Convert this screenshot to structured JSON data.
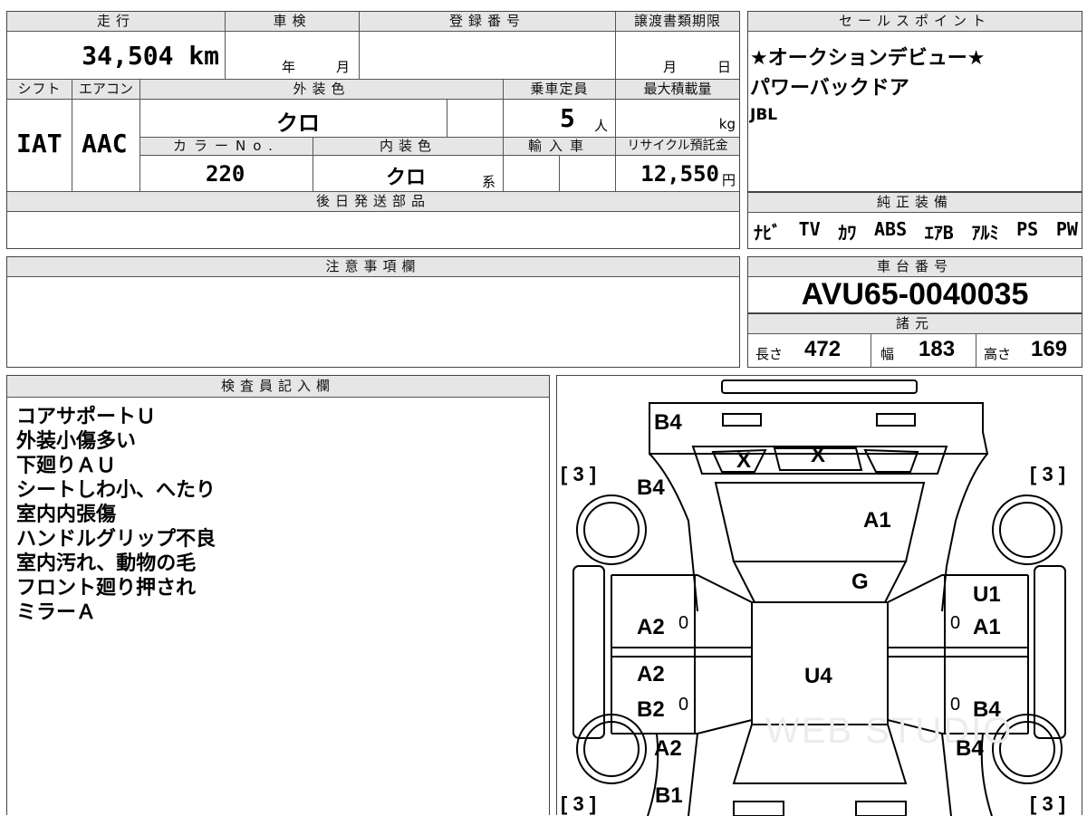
{
  "top_info": {
    "mileage_label": "走行",
    "mileage_value": "34,504 km",
    "inspection_label": "車検",
    "inspection_year_unit": "年",
    "inspection_month_unit": "月",
    "registration_label": "登録番号",
    "transfer_deadline_label": "譲渡書類期限",
    "transfer_month_unit": "月",
    "transfer_day_unit": "日",
    "shift_label": "シフト",
    "shift_value": "IAT",
    "aircon_label": "エアコン",
    "aircon_value": "AAC",
    "exterior_color_label": "外装色",
    "exterior_color_value": "クロ",
    "capacity_label": "乗車定員",
    "capacity_value": "5",
    "capacity_unit": "人",
    "max_load_label": "最大積載量",
    "max_load_unit": "kg",
    "color_no_label": "カラーNo.",
    "color_no_value": "220",
    "interior_color_label": "内装色",
    "interior_color_value": "クロ",
    "interior_color_suffix": "系",
    "import_label": "輸入車",
    "recycle_label": "リサイクル預託金",
    "recycle_value": "12,550",
    "recycle_unit": "円",
    "shipping_parts_label": "後日発送部品"
  },
  "sales_points": {
    "header": "セールスポイント",
    "items": [
      "★オークションデビュー★",
      "パワーバックドア",
      "JBL"
    ]
  },
  "genuine_equipment": {
    "header": "純正装備",
    "items": [
      "ﾅﾋﾞ",
      "TV",
      "ｶﾜ",
      "ABS",
      "ｴｱB",
      "ｱﾙﾐ",
      "PS",
      "PW"
    ]
  },
  "notes": {
    "header": "注意事項欄"
  },
  "chassis": {
    "header": "車台番号",
    "value": "AVU65-0040035"
  },
  "specs": {
    "header": "諸元",
    "length_label": "長さ",
    "length_value": "472",
    "width_label": "幅",
    "width_value": "183",
    "height_label": "高さ",
    "height_value": "169"
  },
  "inspector": {
    "header": "検査員記入欄",
    "lines": [
      "コアサポートＵ",
      "外装小傷多い",
      "下廻りＡＵ",
      "シートしわ小、へたり",
      "室内内張傷",
      "ハンドルグリップ不良",
      "室内汚れ、動物の毛",
      "フロント廻り押され",
      "ミラーＡ"
    ]
  },
  "diagram": {
    "tire_tl": "[ 3 ]",
    "tire_tr": "[ 3 ]",
    "tire_bl": "[ 3 ]",
    "tire_br": "[ 3 ]",
    "marks": {
      "front_bumper": "B4",
      "grille_left": "X",
      "grille_right": "X",
      "fender_front_left": "B4",
      "hood": "A1",
      "windshield": "G",
      "door_right_front_top": "U1",
      "door_left_front": "A2",
      "door_right_front": "A1",
      "door_left_rear_top": "A2",
      "roof": "U4",
      "door_left_rear": "B2",
      "door_right_rear": "B4",
      "quarter_left": "A2",
      "quarter_right": "B4",
      "rear_bumper": "B1"
    },
    "zero_left_front": "0",
    "zero_right_front": "0",
    "zero_left_rear": "0",
    "zero_right_rear": "0",
    "watermark": "WEB STUDIO"
  }
}
